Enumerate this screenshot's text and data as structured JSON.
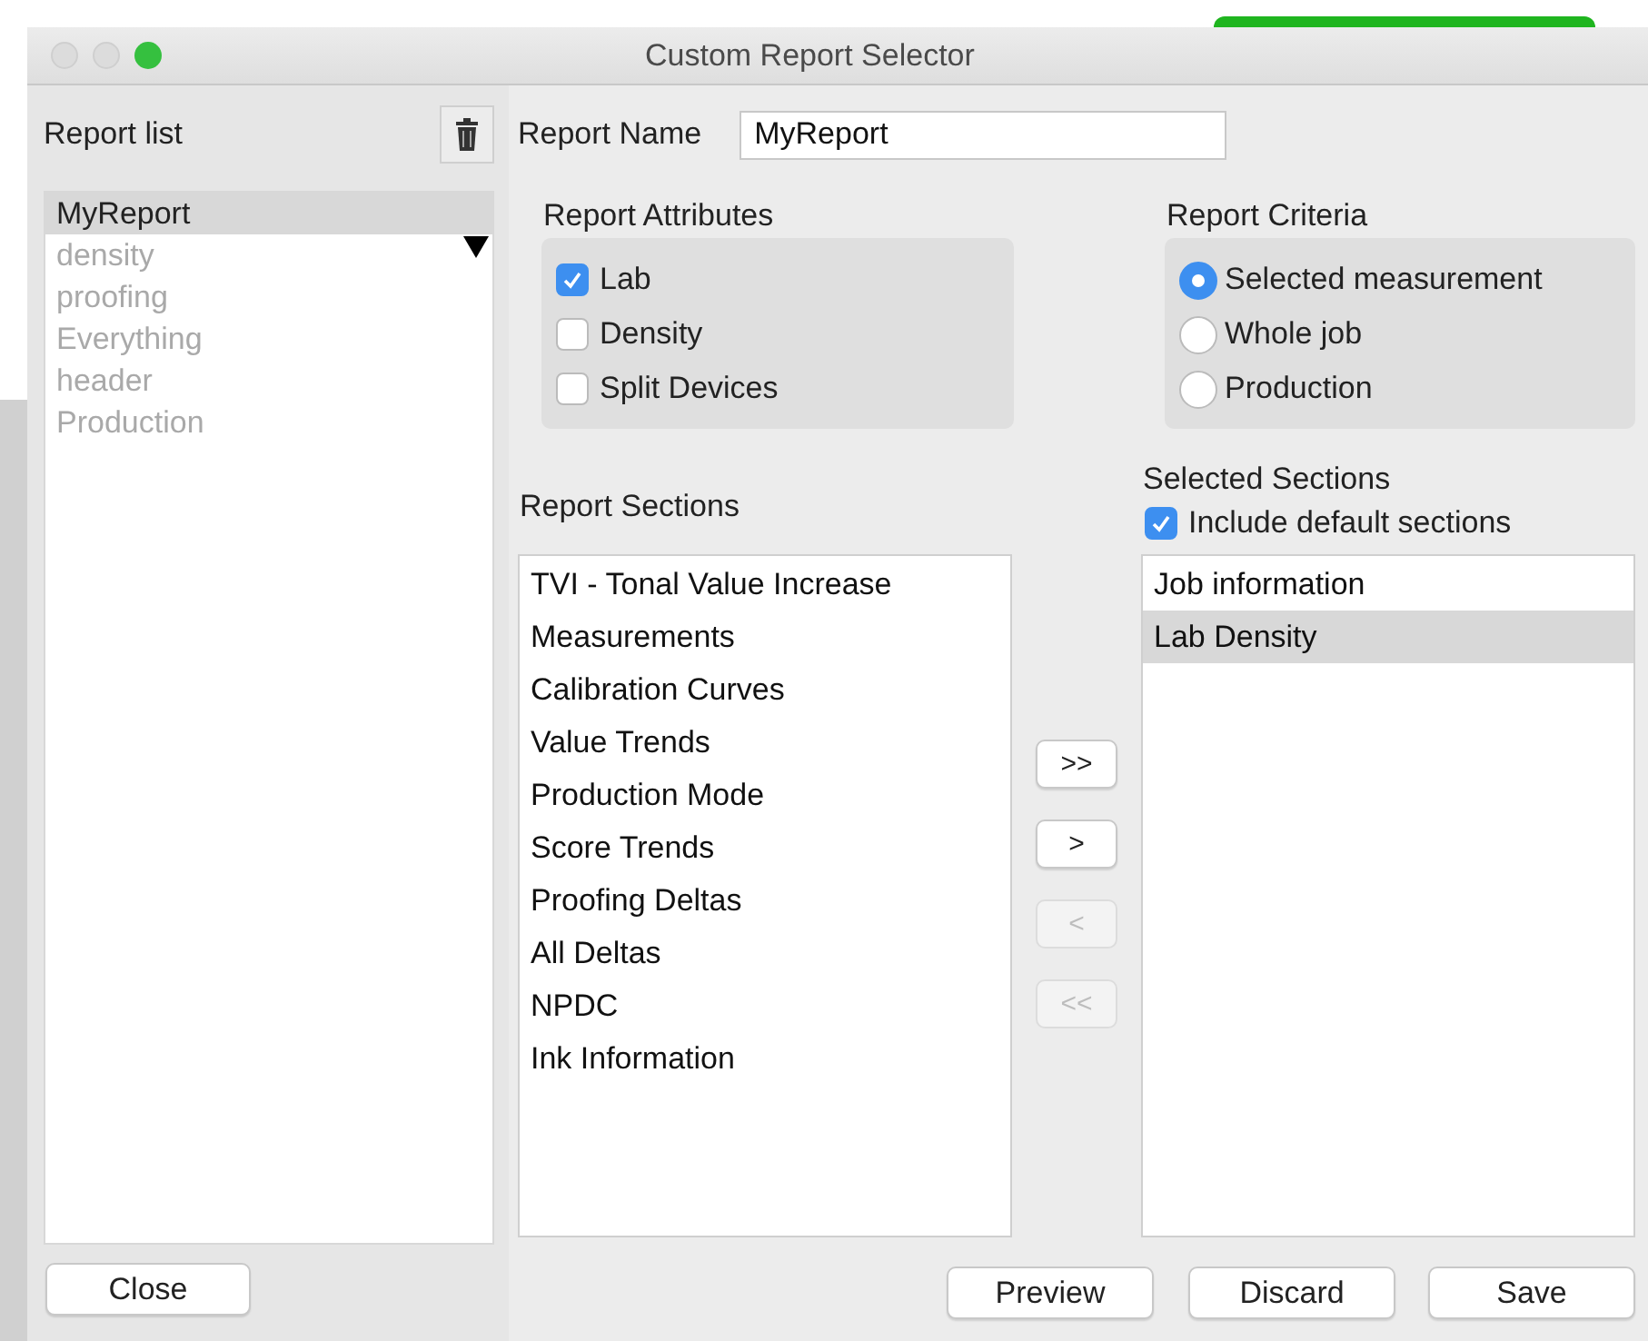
{
  "window": {
    "title": "Custom Report Selector"
  },
  "report_list": {
    "label": "Report list",
    "items": [
      {
        "label": "MyReport",
        "selected": true,
        "disabled": false
      },
      {
        "label": "density",
        "selected": false,
        "disabled": true
      },
      {
        "label": "proofing",
        "selected": false,
        "disabled": true
      },
      {
        "label": "Everything",
        "selected": false,
        "disabled": true
      },
      {
        "label": "header",
        "selected": false,
        "disabled": true
      },
      {
        "label": "Production",
        "selected": false,
        "disabled": true
      }
    ]
  },
  "report_name": {
    "label": "Report Name",
    "value": "MyReport"
  },
  "attributes": {
    "title": "Report Attributes",
    "options": [
      {
        "label": "Lab",
        "checked": true
      },
      {
        "label": "Density",
        "checked": false
      },
      {
        "label": "Split Devices",
        "checked": false
      }
    ]
  },
  "criteria": {
    "title": "Report Criteria",
    "options": [
      {
        "label": "Selected measurement",
        "selected": true
      },
      {
        "label": "Whole job",
        "selected": false
      },
      {
        "label": "Production",
        "selected": false
      }
    ]
  },
  "report_sections": {
    "title": "Report Sections",
    "items": [
      "TVI - Tonal Value Increase",
      "Measurements",
      "Calibration Curves",
      "Value Trends",
      "Production Mode",
      "Score Trends",
      "Proofing Deltas",
      "All Deltas",
      "NPDC",
      "Ink Information"
    ]
  },
  "selected_sections": {
    "title": "Selected Sections",
    "include_default": {
      "label": "Include default sections",
      "checked": true
    },
    "items": [
      {
        "label": "Job information",
        "selected": false
      },
      {
        "label": "Lab Density",
        "selected": true
      }
    ]
  },
  "transfer_buttons": [
    {
      "label": ">>",
      "disabled": false
    },
    {
      "label": ">",
      "disabled": false
    },
    {
      "label": "<",
      "disabled": true
    },
    {
      "label": "<<",
      "disabled": true
    }
  ],
  "buttons": {
    "close": "Close",
    "preview": "Preview",
    "discard": "Discard",
    "save": "Save"
  }
}
